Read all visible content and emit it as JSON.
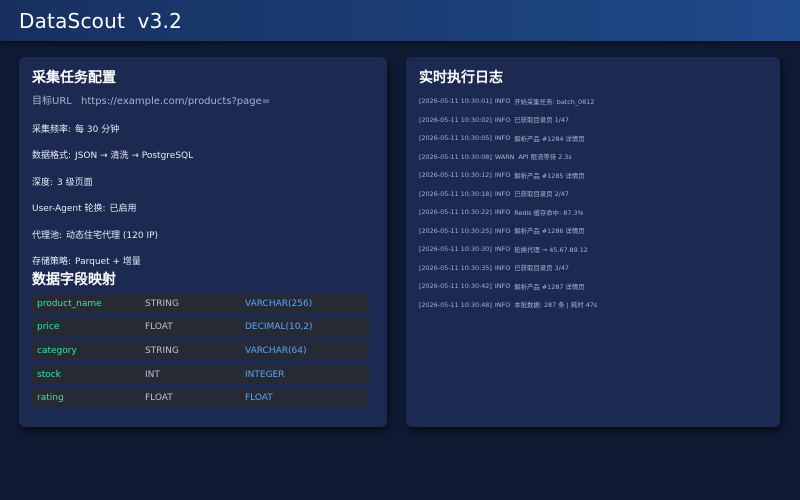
{
  "app": {
    "title": "DataScout  v3.2"
  },
  "config": {
    "title": "采集任务配置",
    "url_label": "目标URL",
    "url_value": "https://example.com/products?page=",
    "rows": [
      {
        "key": "采集频率:",
        "value": "每 30 分钟"
      },
      {
        "key": "数据格式:",
        "value": "JSON → 清洗 → PostgreSQL"
      },
      {
        "key": "深度:",
        "value": "3 级页面"
      },
      {
        "key": "User-Agent 轮换:",
        "value": "已启用"
      },
      {
        "key": "代理池:",
        "value": "动态住宅代理 (120 IP)"
      },
      {
        "key": "存储策略:",
        "value": "Parquet + 增量"
      }
    ]
  },
  "mapping": {
    "title": "数据字段映射",
    "rows": [
      {
        "field": "product_name",
        "type": "STRING",
        "db": "VARCHAR(256)"
      },
      {
        "field": "price",
        "type": "FLOAT",
        "db": "DECIMAL(10,2)"
      },
      {
        "field": "category",
        "type": "STRING",
        "db": "VARCHAR(64)"
      },
      {
        "field": "stock",
        "type": "INT",
        "db": "INTEGER"
      },
      {
        "field": "rating",
        "type": "FLOAT",
        "db": "FLOAT"
      }
    ]
  },
  "log": {
    "title": "实时执行日志",
    "lines": [
      {
        "ts": "[2026-05-11 10:30:01]",
        "level": "INFO",
        "msg": "开始采集任务: batch_0812"
      },
      {
        "ts": "[2026-05-11 10:30:02]",
        "level": "INFO",
        "msg": "已获取目录页 1/47"
      },
      {
        "ts": "[2026-05-11 10:30:05]",
        "level": "INFO",
        "msg": "解析产品 #1284 详情页"
      },
      {
        "ts": "[2026-05-11 10:30:08]",
        "level": "WARN",
        "msg": "API 限流等待 2.3s"
      },
      {
        "ts": "[2026-05-11 10:30:12]",
        "level": "INFO",
        "msg": "解析产品 #1285 详情页"
      },
      {
        "ts": "[2026-05-11 10:30:18]",
        "level": "INFO",
        "msg": "已获取目录页 2/47"
      },
      {
        "ts": "[2026-05-11 10:30:22]",
        "level": "INFO",
        "msg": "Redis 缓存命中: 87.3%"
      },
      {
        "ts": "[2026-05-11 10:30:25]",
        "level": "INFO",
        "msg": "解析产品 #1286 详情页"
      },
      {
        "ts": "[2026-05-11 10:30:30]",
        "level": "INFO",
        "msg": "轮换代理 → 45.67.89.12"
      },
      {
        "ts": "[2026-05-11 10:30:35]",
        "level": "INFO",
        "msg": "已获取目录页 3/47"
      },
      {
        "ts": "[2026-05-11 10:30:42]",
        "level": "INFO",
        "msg": "解析产品 #1287 详情页"
      },
      {
        "ts": "[2026-05-11 10:30:48]",
        "level": "INFO",
        "msg": "本批数据: 287 条 | 耗时 47s"
      }
    ]
  }
}
